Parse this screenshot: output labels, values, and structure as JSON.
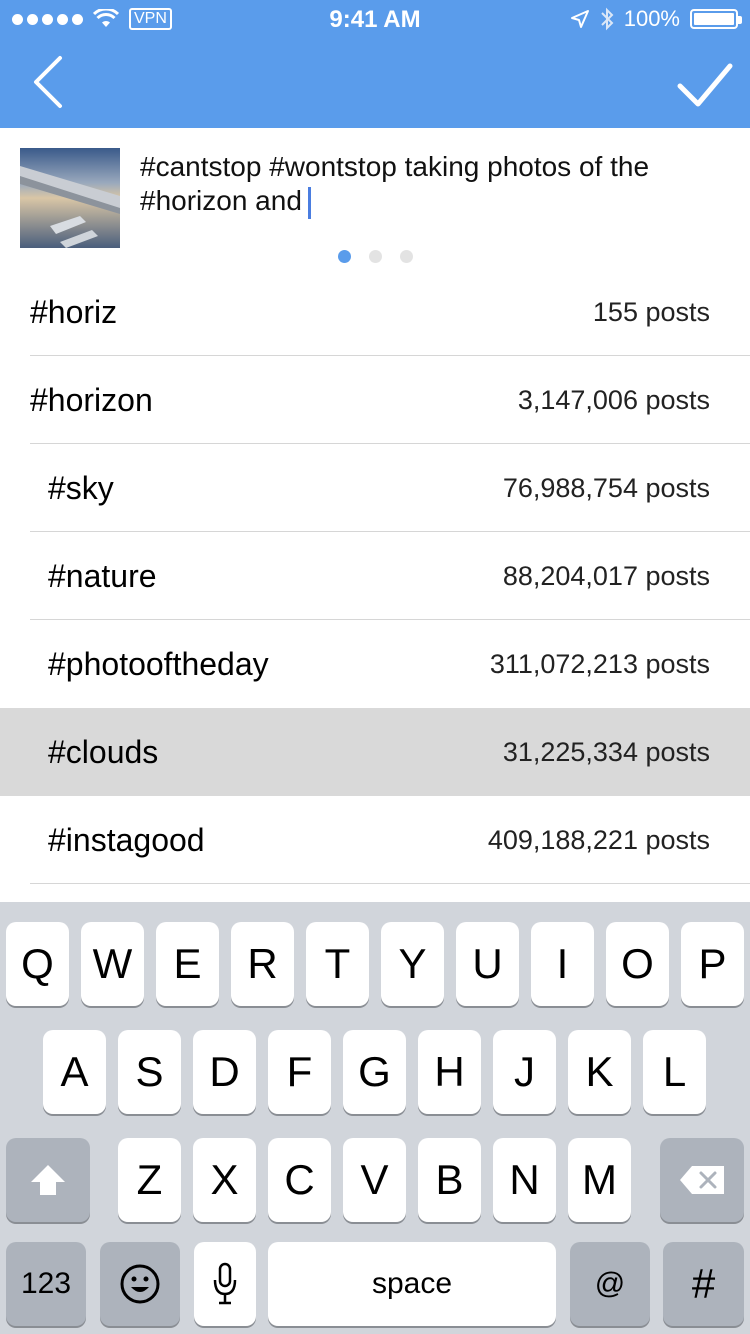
{
  "status_bar": {
    "signal_dots": 5,
    "vpn": "VPN",
    "time": "9:41 AM",
    "battery": "100%"
  },
  "nav": {
    "back_icon": "chevron-left-icon",
    "done_icon": "checkmark-icon",
    "accent": "#5a9ceb"
  },
  "caption": {
    "text": "#cantstop #wontstop taking photos of the #horizon and",
    "page_index": 1,
    "page_count": 3
  },
  "suggestions": [
    {
      "tag": "#horiz",
      "count": "155 posts",
      "selected": false
    },
    {
      "tag": "#horizon",
      "count": "3,147,006 posts",
      "selected": false
    },
    {
      "tag": "#sky",
      "count": "76,988,754 posts",
      "selected": false
    },
    {
      "tag": "#nature",
      "count": "88,204,017 posts",
      "selected": false
    },
    {
      "tag": "#photooftheday",
      "count": "311,072,213 posts",
      "selected": false
    },
    {
      "tag": "#clouds",
      "count": "31,225,334 posts",
      "selected": true
    },
    {
      "tag": "#instagood",
      "count": "409,188,221 posts",
      "selected": false
    }
  ],
  "keyboard": {
    "row1": [
      "Q",
      "W",
      "E",
      "R",
      "T",
      "Y",
      "U",
      "I",
      "O",
      "P"
    ],
    "row2": [
      "A",
      "S",
      "D",
      "F",
      "G",
      "H",
      "J",
      "K",
      "L"
    ],
    "row3": [
      "Z",
      "X",
      "C",
      "V",
      "B",
      "N",
      "M"
    ],
    "numbers": "123",
    "space": "space",
    "at": "@",
    "hash": "#"
  }
}
